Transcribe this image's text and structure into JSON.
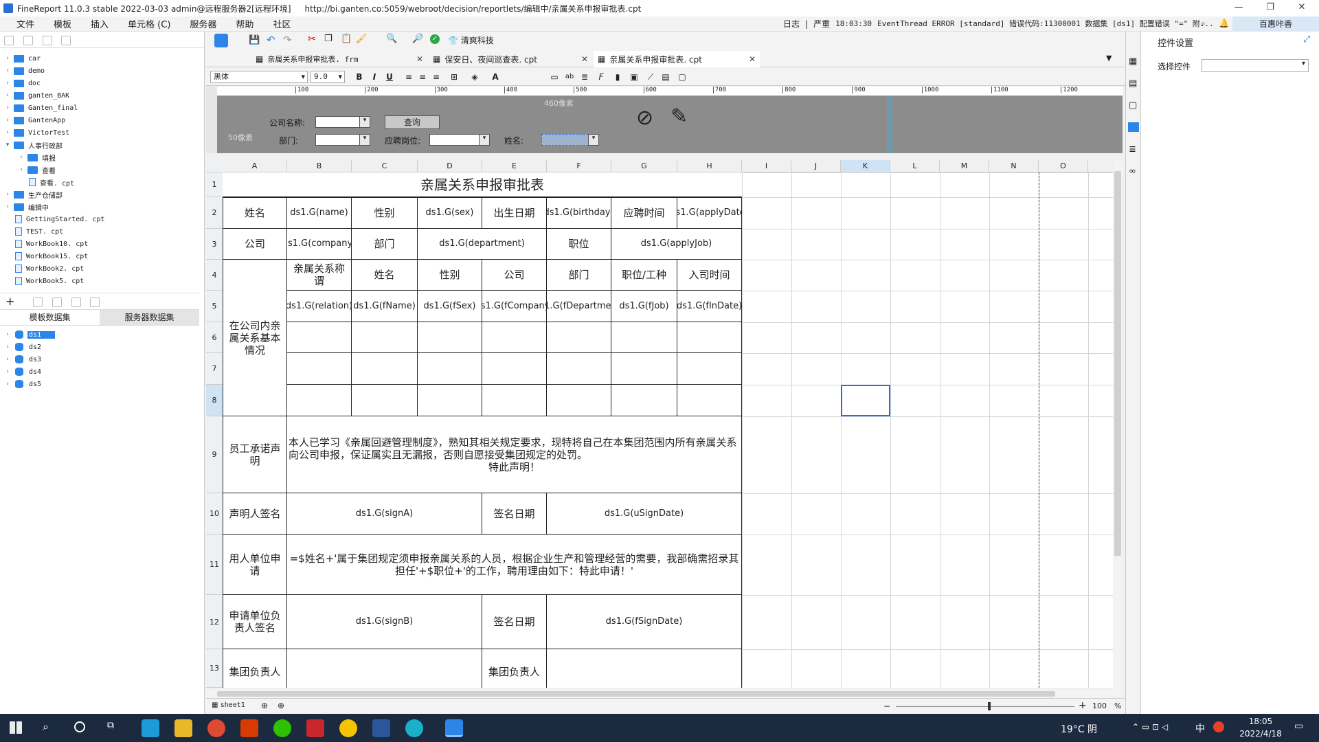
{
  "window": {
    "title": "FineReport 11.0.3 stable 2022-03-03 admin@远程服务器2[远程环境]",
    "url": "http://bi.ganten.co:5059/webroot/decision/reportlets/编辑中/亲属关系申报审批表.cpt"
  },
  "menu": [
    "文件",
    "模板",
    "插入",
    "单元格 (C)",
    "服务器",
    "帮助",
    "社区"
  ],
  "log": {
    "label": "日志",
    "level": "严重",
    "time": "18:03:30",
    "message": "EventThread ERROR [standard] 错误代码:11300001 数据集 [ds1] 配置错误 \"=\" 附..."
  },
  "user": "百惠咔香",
  "toolbar": {
    "brand": "清爽科技"
  },
  "file_tabs": [
    "亲属关系申报审批表. frm",
    "保安日、夜间巡查表. cpt",
    "亲属关系申报审批表. cpt"
  ],
  "format": {
    "font": "黑体",
    "size": "9.0"
  },
  "tree": [
    {
      "label": "car",
      "type": "folder",
      "depth": 0
    },
    {
      "label": "demo",
      "type": "folder",
      "depth": 0
    },
    {
      "label": "doc",
      "type": "folder",
      "depth": 0
    },
    {
      "label": "ganten_BAK",
      "type": "folder",
      "depth": 0
    },
    {
      "label": "Ganten_final",
      "type": "folder",
      "depth": 0
    },
    {
      "label": "GantenApp",
      "type": "folder",
      "depth": 0
    },
    {
      "label": "VictorTest",
      "type": "folder",
      "depth": 0
    },
    {
      "label": "人事行政部",
      "type": "folder",
      "depth": 0,
      "open": true
    },
    {
      "label": "填报",
      "type": "folder",
      "depth": 1
    },
    {
      "label": "查看",
      "type": "folder",
      "depth": 1
    },
    {
      "label": "查看. cpt",
      "type": "file",
      "depth": 1
    },
    {
      "label": "生产仓储部",
      "type": "folder",
      "depth": 0
    },
    {
      "label": "编辑中",
      "type": "folder",
      "depth": 0
    },
    {
      "label": "GettingStarted. cpt",
      "type": "file",
      "depth": 0
    },
    {
      "label": "TEST. cpt",
      "type": "file",
      "depth": 0
    },
    {
      "label": "WorkBook10. cpt",
      "type": "file",
      "depth": 0
    },
    {
      "label": "WorkBook15. cpt",
      "type": "file",
      "depth": 0
    },
    {
      "label": "WorkBook2. cpt",
      "type": "file",
      "depth": 0
    },
    {
      "label": "WorkBook5. cpt",
      "type": "file",
      "depth": 0
    }
  ],
  "dataset_tabs": [
    "模板数据集",
    "服务器数据集"
  ],
  "datasets": [
    "ds1",
    "ds2",
    "ds3",
    "ds4",
    "ds5"
  ],
  "ruler": [
    "100",
    "200",
    "300",
    "400",
    "500",
    "600",
    "700",
    "800",
    "900",
    "1000",
    "1100",
    "1200"
  ],
  "param": {
    "company": "公司名称:",
    "query": "查询",
    "dept": "部门:",
    "job": "应聘岗位:",
    "name": "姓名:",
    "w": "460像素",
    "h": "50像素"
  },
  "columns": [
    "A",
    "B",
    "C",
    "D",
    "E",
    "F",
    "G",
    "H",
    "I",
    "J",
    "K",
    "L",
    "M",
    "N",
    "O"
  ],
  "rows": [
    "1",
    "2",
    "3",
    "4",
    "5",
    "6",
    "7",
    "8",
    "9",
    "10",
    "11",
    "12",
    "13"
  ],
  "sheet": {
    "title": "亲属关系申报审批表",
    "r2": [
      "姓名",
      "ds1.G(name)",
      "性别",
      "ds1.G(sex)",
      "出生日期",
      "ds1.G(birthday)",
      "应聘时间",
      "ds1.G(applyDate)"
    ],
    "r3": [
      "公司",
      "ds1.G(company)",
      "部门",
      "ds1.G(department)",
      "职位",
      "ds1.G(applyJob)"
    ],
    "r4": [
      "亲属关系称谓",
      "姓名",
      "性别",
      "公司",
      "部门",
      "职位/工种",
      "入司时间"
    ],
    "r5": [
      "ds1.G(relation)",
      "ds1.G(fName)",
      "ds1.G(fSex)",
      "ds1.G(fCompany)",
      "ds1.G(fDepartment)",
      "ds1.G(fJob)",
      "ds1.G(fInDate)"
    ],
    "side": "在公司内亲属关系基本情况",
    "r9a": "员工承诺声明",
    "r9b": "本人已学习《亲属回避管理制度》，熟知其相关规定要求，现特将自己在本集团范围内所有亲属关系向公司申报，保证属实且无漏报，否则自愿接受集团规定的处罚。",
    "r9c": "特此声明！",
    "r10": [
      "声明人签名",
      "ds1.G(signA)",
      "签名日期",
      "ds1.G(uSignDate)"
    ],
    "r11a": "用人单位申请",
    "r11b": "=$姓名+'属于集团规定须申报亲属关系的人员，根据企业生产和管理经营的需要，我部确需招录其担任'+$职位+'的工作，聘用理由如下：特此申请！'",
    "r12": [
      "申请单位负责人签名",
      "ds1.G(signB)",
      "签名日期",
      "ds1.G(fSignDate)"
    ],
    "r13": [
      "集团负责人",
      "集团负责人"
    ]
  },
  "right": {
    "title": "控件设置",
    "select": "选择控件"
  },
  "status": {
    "sheet": "sheet1",
    "zoom": "100",
    "pct": "%"
  },
  "taskbar": {
    "weather": "19°C 阴",
    "time": "18:05",
    "date": "2022/4/18",
    "ime": "中"
  }
}
